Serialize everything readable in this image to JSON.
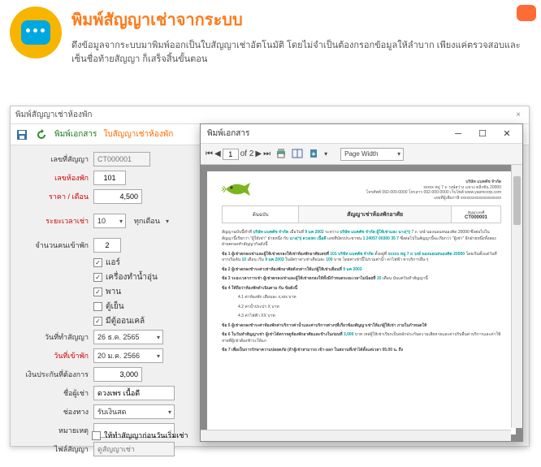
{
  "header": {
    "title": "พิมพ์สัญญาเช่าจากระบบ",
    "subtitle": "ดึงข้อมูลจากระบบมาพิมพ์ออกเป็นใบสัญญาเช่าอัตโนมัติ โดยไม่จำเป็นต้องกรอกข้อมูลให้ลำบาก เพียงแค่ตรวจสอบและเซ็นชื่อท้ายสัญญา ก็เสร็จสิ้นขั้นตอน"
  },
  "main_window": {
    "title": "พิมพ์สัญญาเช่าห้องพัก",
    "toolbar": {
      "link1": "พิมพ์เอกสาร",
      "link2": "ใบสัญญาเช่าห้องพัก"
    },
    "form": {
      "contract_no_label": "เลขที่สัญญา",
      "contract_no": "CT000001",
      "room_no_label": "เลขห้องพัก",
      "room_no": "101",
      "price_label": "ราคา / เดือน",
      "price": "4,500",
      "rental_period_label": "ระยะเวลาเช่า",
      "rental_period": "10",
      "period_opt": "ทุกเดือน",
      "tenants_label": "จำนวนคนเข้าพัก",
      "tenants": "2",
      "cb_aircon": "แอร์",
      "cb_furniture": "เครื่องทำน้ำอุ่น",
      "cb_fan": "พาน",
      "cb_fridge": "ตู้เย็น",
      "cb_other": "มีตู้ออนเคล้",
      "contract_date_label": "วันที่ทำสัญญา",
      "contract_date": "26 ธ.ค. 2565",
      "checkin_label": "วันที่เข้าพัก",
      "checkin": "20 ม.ค. 2566",
      "deposit_label": "เงินประกันที่ต้องการ",
      "deposit": "3,000",
      "tenant_name_label": "ชื่อผู้เช่า",
      "tenant_name": "ดวงเพร เนื้อดี",
      "payment_label": "ช่องทาง",
      "payment": "รับเงินสด",
      "note_label": "หมายเหตุ",
      "contract_file_label": "ไฟล์สัญญา",
      "contract_file": "ดูสัญญาเช่า",
      "bottom_cb": "ให้ทำสัญญาก่อนวันเริ่มเช่า"
    }
  },
  "print_window": {
    "title": "พิมพ์เอกสาร",
    "toolbar": {
      "page_current": "1",
      "page_text": "of 2",
      "zoom": "Page Width"
    },
    "document": {
      "company_name": "บริษัท แบคคัช จำกัด",
      "company_addr": "xxxxx หมู่ 7 ถ วงษ์สว่าง แขวง ตลิ่งชัน 20000",
      "company_contact": "โทรศัพท์ 092-000-0000  โทรสาร 092-000-0000  เว็บไซต์ www.yaomcorp.com",
      "company_taxid": "เลขที่ผู้เสียภาษี xxxxxxxxxxxxxxxxxxxx",
      "banner_left": "ต้นฉบับ",
      "banner_main": "สัญญาเช่าห้องพักอาศัย",
      "banner_right_label": "สัญญาเลขที่",
      "banner_right_value": "CT000001",
      "body": {
        "intro": "สัญญาฉบับนี้ทำที่",
        "company_hl": "บริษัท แบคคัช จำกัด",
        "date_pre": "เมื่อวันที่",
        "date_hl": "9 มค 2002",
        "between": "ระหว่าง",
        "party_hl": "บริษัท แบคคัช จำกัด ผู้ให้เช่าและ นาง(ฯ)",
        "addr_pre": "7 ถ วงษ์ นองนอนหนองคิด 20000 ซึ่งต่อไปในสัญญานี้เรียกว่า \"ผู้ให้เช่า\" ฝ่ายหนึ่ง กับ",
        "tenant_hl": "นาง(ฯ) ดวงเพร เนื้อดี",
        "id_hl": "1 24057 00300 35 7",
        "tenant_post": "ซึ่งต่อไปในสัญญานี้จะเรียกว่า \"ผู้เช่า\" อีกฝ่ายหนึ่งทั้งสองฝ่ายตกลงทำสัญญากันดังนี้",
        "c1_pre": "ข้อ 1 ผู้เช่าตกลงเช่าและผู้ให้เช่าตกลงให้เช่าห้องพักอาศัยเลขที่",
        "c1_room": "101",
        "c1_building": "บริษัท แบคคัช จำกัด",
        "c1_addr_pre": "ตั้งอยู่ที่",
        "c1_addr": "xxxxx หมู่ 7 ถ วงษ์ นองนอนหนองคิด 20000",
        "c1_period_pre": "โดยเริ่มตั้งแต่วันที่จากเริ่มต้น",
        "c1_period": "10",
        "c1_start": "9 มค 2003",
        "c1_rate": "100",
        "c2_pre": "ข้อ 2 ผู้เช่าตกลงชำระค่าเช่าห้องพักอาศัยดังกล่าวให้แก่ผู้ให้เช่าเดือนที่",
        "c2_date": "9 มค 2003",
        "c3_pre": "ข้อ 3 ระยะเวลาการเช่า ผู้เช่าตกลงเช่าและผู้ให้เช่าตกลงให้ทั้งมีกำหนดระยะเวลาไม่น้อยที่",
        "c3_month": "10",
        "c3_post": "เดือน นับแต่วันทำสัญญานี้",
        "c4": "ข้อ 4 ให้ถือว่าห้องพักดำเนินตาม กัน ข้อดังนี้",
        "c4_b1": "4.1 ค่าห้องพัก เดือนละ x,xxx บาท",
        "c4_b2": "4.2 ค่าน้ำประปา X บาท",
        "c4_b3": "4.3 ค่าไฟฟ้า XX บาท",
        "c5": "ข้อ 5 ผู้เช่าตกลงชำระค่าห้องพักค่าบริการค่าน้ำและค่าบริการต่างๆที่เกี่ยวข้องสัญญาเช่าให้แก่ผู้ให้เช่า ภายในกำหนดให้",
        "c6_pre": "ข้อ 6 ในวันทำสัญญาเช่า ผู้เช่าได้ตรวจดูห้องพักอาศัยและข้างในก่อนที่",
        "c6_deposit": "3,000",
        "c6_post": "บาท เหล่ผู้ให้เช่าเรียกเป็นหลักประกันความเสียหายและค่าปรับอื่นค่าบริการและค่าใช้จ่ายที่ผู้เช่าต้องชำระให้แก",
        "c7": "ข้อ 7 เพื่อเป็นการรักษาความปลอดภัย (ถ้าผู้เช่าสามารถ เข้า-ออก ในสถานที่เช่าได้ตั้งแต่เวลา 05.00 น. ถึง"
      }
    }
  }
}
